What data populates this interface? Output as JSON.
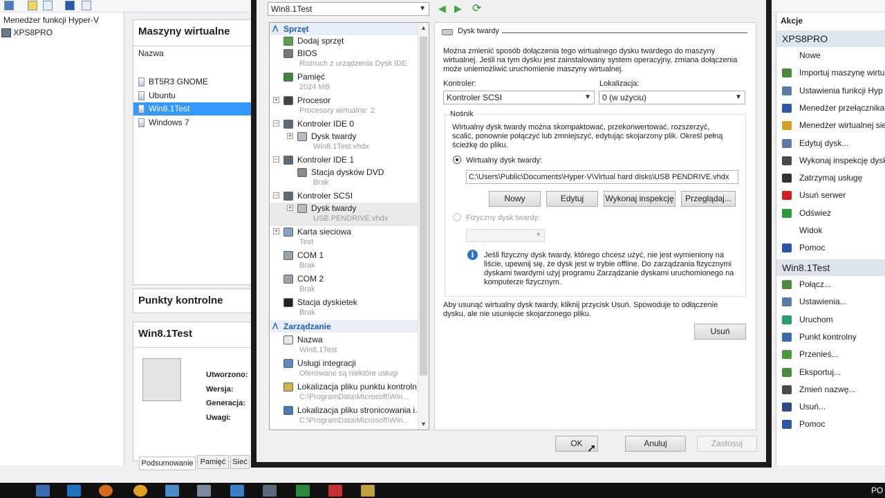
{
  "tree": {
    "root": "Menedżer funkcji Hyper-V",
    "server": "XPS8PRO"
  },
  "middle": {
    "vms_title": "Maszyny wirtualne",
    "col_name": "Nazwa",
    "vms": [
      "BT5R3 GNOME",
      "Ubuntu",
      "Win8.1Test",
      "Windows 7"
    ],
    "selected_vm_index": 2,
    "checkpoints_title": "Punkty kontrolne",
    "details_title": "Win8.1Test",
    "detail_labels": [
      "Utworzono:",
      "Wersja:",
      "Generacja:",
      "Uwagi:"
    ],
    "tabs": [
      "Podsumowanie",
      "Pamięć",
      "Sieć"
    ]
  },
  "dialog": {
    "vm_select": "Win8.1Test",
    "sections": {
      "hardware": "Sprzęt",
      "management": "Zarządzanie"
    },
    "hardware_items": [
      {
        "label": "Dodaj sprzęt",
        "sub": ""
      },
      {
        "label": "BIOS",
        "sub": "Rozruch z urządzenia Dysk IDE"
      },
      {
        "label": "Pamięć",
        "sub": "2024 MB"
      },
      {
        "label": "Procesor",
        "sub": "Procesory wirtualne: 2"
      },
      {
        "label": "Kontroler IDE 0",
        "sub": ""
      },
      {
        "label": "Dysk twardy",
        "sub": "Win8.1Test.vhdx"
      },
      {
        "label": "Kontroler IDE 1",
        "sub": ""
      },
      {
        "label": "Stacja dysków DVD",
        "sub": "Brak"
      },
      {
        "label": "Kontroler SCSI",
        "sub": ""
      },
      {
        "label": "Dysk twardy",
        "sub": "USB PENDRIVE.vhdx"
      },
      {
        "label": "Karta sieciowa",
        "sub": "Test"
      },
      {
        "label": "COM 1",
        "sub": "Brak"
      },
      {
        "label": "COM 2",
        "sub": "Brak"
      },
      {
        "label": "Stacja dyskietek",
        "sub": "Brak"
      }
    ],
    "management_items": [
      {
        "label": "Nazwa",
        "sub": "Win8.1Test"
      },
      {
        "label": "Usługi integracji",
        "sub": "Oferowane są niektóre usługi"
      },
      {
        "label": "Lokalizacja pliku punktu kontroln...",
        "sub": "C:\\ProgramData\\Microsoft\\Win..."
      },
      {
        "label": "Lokalizacja pliku stronicowania i...",
        "sub": "C:\\ProgramData\\Microsoft\\Win..."
      }
    ],
    "panel": {
      "title": "Dysk twardy",
      "intro": [
        "Można zmienić sposób dołączenia tego wirtualnego dysku twardego do maszyny",
        "wirtualnej. Jeśli na tym dysku jest zainstalowany system operacyjny, zmiana dołączenia",
        "może uniemożliwić uruchomienie maszyny wirtualnej."
      ],
      "controller_label": "Kontroler:",
      "controller_value": "Kontroler SCSI",
      "location_label": "Lokalizacja:",
      "location_value": "0 (w użyciu)",
      "media_label": "Nośnik",
      "media_desc": [
        "Wirtualny dysk twardy można skompaktować, przekonwertować, rozszerzyć,",
        "scalić, ponownie połączyć lub zmniejszyć, edytując skojarzony plik. Określ pełną",
        "ścieżkę do pliku."
      ],
      "virtual_radio": "Wirtualny dysk twardy:",
      "path": "C:\\Users\\Public\\Documents\\Hyper-V\\Virtual hard disks\\USB PENDRIVE.vhdx",
      "btn_new": "Nowy",
      "btn_edit": "Edytuj",
      "btn_inspect": "Wykonaj inspekcję",
      "btn_browse": "Przeglądaj...",
      "physical_radio": "Fizyczny dysk twardy:",
      "info": [
        "Jeśli fizyczny dysk twardy, którego chcesz użyć, nie jest wymieniony na",
        "liście, upewnij się, że dysk jest w trybie offline. Do zarządzania fizycznymi",
        "dyskami twardymi użyj programu Zarządzanie dyskami uruchomionego na",
        "komputerze fizycznym."
      ],
      "remove_desc": [
        "Aby usunąć wirtualny dysk twardy, kliknij przycisk Usuń. Spowoduje to odłączenie",
        "dysku, ale nie usunięcie skojarzonego pliku."
      ],
      "btn_remove": "Usuń"
    },
    "btn_ok": "OK",
    "btn_cancel": "Anuluj",
    "btn_apply": "Zastosuj"
  },
  "actions": {
    "title": "Akcje",
    "group1": "XPS8PRO",
    "items1": [
      "Nowe",
      "Importuj maszynę wirtu",
      "Ustawienia funkcji Hyp",
      "Menedżer przełącznika",
      "Menedżer wirtualnej sie",
      "Edytuj dysk...",
      "Wykonaj inspekcję dysk",
      "Zatrzymaj usługę",
      "Usuń serwer",
      "Odśwież",
      "Widok",
      "Pomoc"
    ],
    "group2": "Win8.1Test",
    "items2": [
      "Połącz...",
      "Ustawienia...",
      "Uruchom",
      "Punkt kontrolny",
      "Przenieś...",
      "Eksportuj...",
      "Zmień nazwę...",
      "Usuń...",
      "Pomoc"
    ]
  },
  "taskbar": {
    "tray_text": "PO"
  }
}
